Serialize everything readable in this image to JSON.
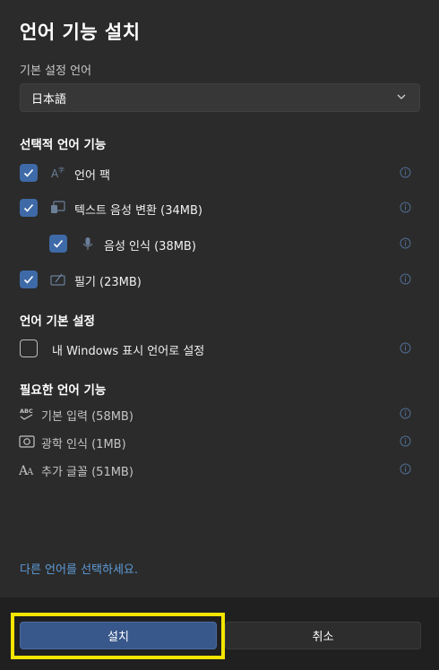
{
  "dialog": {
    "title": "언어 기능 설치",
    "preferred_language_label": "기본 설정 언어",
    "preferred_language_value": "日本語",
    "optional_section": "선택적 언어 기능",
    "optional_items": [
      {
        "label": "언어 팩",
        "checked": true,
        "icon": "language-pack-icon"
      },
      {
        "label": "텍스트 음성 변환 (34MB)",
        "checked": true,
        "icon": "text-to-speech-icon"
      },
      {
        "label": "음성 인식 (38MB)",
        "checked": true,
        "icon": "microphone-icon"
      },
      {
        "label": "필기 (23MB)",
        "checked": true,
        "icon": "handwriting-icon"
      }
    ],
    "preferences_section": "언어 기본 설정",
    "display_language_option": {
      "label": "내 Windows 표시 언어로 설정",
      "checked": false
    },
    "required_section": "필요한 언어 기능",
    "required_items": [
      {
        "label": "기본 입력 (58MB)",
        "icon": "abc-typing-icon"
      },
      {
        "label": "광학 인식 (1MB)",
        "icon": "ocr-icon"
      },
      {
        "label": "추가 글꼴 (51MB)",
        "icon": "font-icon"
      }
    ],
    "link_text": "다른 언어를 선택하세요.",
    "install_button": "설치",
    "cancel_button": "취소"
  },
  "colors": {
    "background": "#2b2b2b",
    "footer": "#202020",
    "accent": "#3f6aa8",
    "link": "#5e9bd6",
    "highlight": "#f5e500"
  }
}
